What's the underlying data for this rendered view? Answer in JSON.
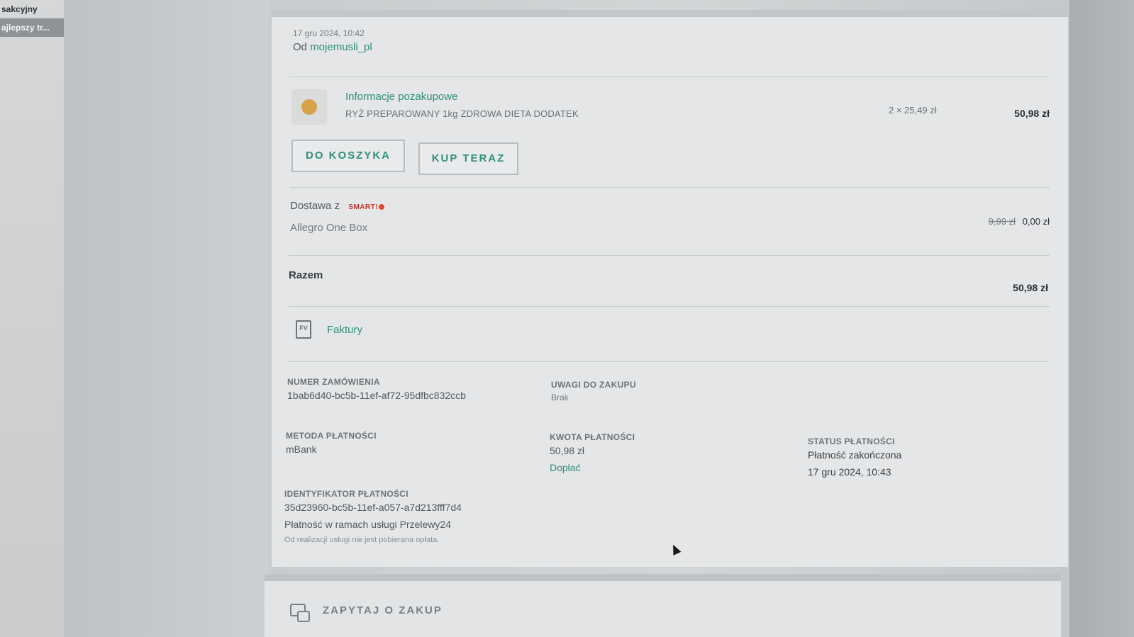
{
  "sidebar": {
    "items": [
      {
        "label": "sakcyjny"
      },
      {
        "label": "ajlepszy tr..."
      }
    ]
  },
  "order": {
    "date": "17 gru 2024, 10:42",
    "from_prefix": "Od",
    "seller": "mojemusli_pl",
    "product": {
      "section_title": "Informacje pozakupowe",
      "name": "RYŻ PREPAROWANY 1kg ZDROWA DIETA DODATEK",
      "quantity_price": "2 × 25,49 zł",
      "total": "50,98 zł",
      "image_icon": "product-thumbnail"
    },
    "buttons": {
      "add_to_cart": "DO KOSZYKA",
      "buy_now": "KUP TERAZ"
    },
    "delivery": {
      "label": "Dostawa z",
      "badge": "SMART!",
      "service": "Allegro One Box",
      "old_price": "9,99 zł",
      "price": "0,00 zł"
    },
    "total": {
      "label": "Razem",
      "value": "50,98 zł"
    },
    "invoices": {
      "icon_text": "FV",
      "label": "Faktury"
    },
    "details": {
      "order_number_label": "NUMER ZAMÓWIENIA",
      "order_number": "1bab6d40-bc5b-11ef-af72-95dfbc832ccb",
      "notes_label": "UWAGI DO ZAKUPU",
      "notes": "Brak",
      "payment_method_label": "METODA PŁATNOŚCI",
      "payment_method": "mBank",
      "payment_amount_label": "KWOTA PŁATNOŚCI",
      "payment_amount": "50,98 zł",
      "pay_more": "Dopłać",
      "payment_status_label": "STATUS PŁATNOŚCI",
      "payment_status": "Płatność zakończona",
      "payment_status_date": "17 gru 2024, 10:43",
      "payment_id_label": "IDENTYFIKATOR PŁATNOŚCI",
      "payment_id": "35d23960-bc5b-11ef-a057-a7d213fff7d4",
      "payment_service": "Płatność w ramach usługi Przelewy24",
      "payment_fee_note": "Od realizacji usługi nie jest pobierana opłata."
    }
  },
  "ask": {
    "label": "ZAPYTAJ O ZAKUP"
  },
  "colors": {
    "accent": "#2f8f7a",
    "smart_badge": "#c0392b"
  }
}
